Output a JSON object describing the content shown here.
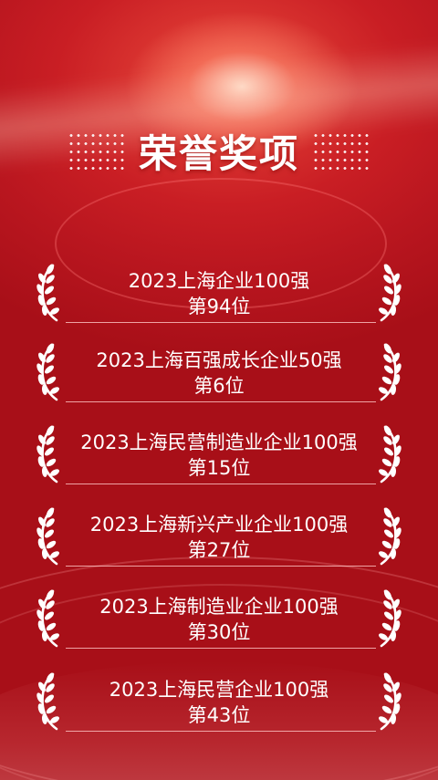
{
  "header": {
    "title": "荣誉奖项"
  },
  "awards": [
    {
      "name": "2023上海企业100强",
      "rank": "第94位"
    },
    {
      "name": "2023上海百强成长企业50强",
      "rank": "第6位"
    },
    {
      "name": "2023上海民营制造业企业100强",
      "rank": "第15位"
    },
    {
      "name": "2023上海新兴产业企业100强",
      "rank": "第27位"
    },
    {
      "name": "2023上海制造业企业100强",
      "rank": "第30位"
    },
    {
      "name": "2023上海民营企业100强",
      "rank": "第43位"
    }
  ],
  "colors": {
    "background": "#c3181f",
    "text": "#ffffff"
  },
  "icons": {
    "laurel": "laurel-wreath-icon",
    "dots": "dot-grid-ornament"
  }
}
